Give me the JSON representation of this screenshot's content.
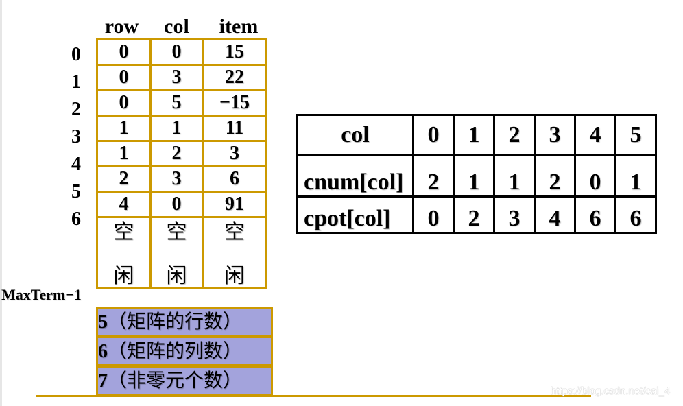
{
  "triple_table": {
    "headers": [
      "row",
      "col",
      "item"
    ],
    "index_labels": [
      "0",
      "1",
      "2",
      "3",
      "4",
      "5",
      "6"
    ],
    "rows": [
      {
        "row": "0",
        "col": "0",
        "item": "15"
      },
      {
        "row": "0",
        "col": "3",
        "item": "22"
      },
      {
        "row": "0",
        "col": "5",
        "item": "−15"
      },
      {
        "row": "1",
        "col": "1",
        "item": "11"
      },
      {
        "row": "1",
        "col": "2",
        "item": "3"
      },
      {
        "row": "2",
        "col": "3",
        "item": "6"
      },
      {
        "row": "4",
        "col": "0",
        "item": "91"
      }
    ],
    "free_cells": {
      "top": "空",
      "bottom": "闲"
    },
    "maxterm_label": "MaxTerm−1",
    "meta_rows": [
      {
        "num": "5",
        "text": "（矩阵的行数）"
      },
      {
        "num": "6",
        "text": "（矩阵的列数）"
      },
      {
        "num": "7",
        "text": "（非零元个数）"
      }
    ]
  },
  "count_table": {
    "rows": [
      {
        "label": "col",
        "values": [
          "0",
          "1",
          "2",
          "3",
          "4",
          "5"
        ]
      },
      {
        "label": "cnum[col]",
        "values": [
          "2",
          "1",
          "1",
          "2",
          "0",
          "1"
        ]
      },
      {
        "label": "cpot[col]",
        "values": [
          "0",
          "2",
          "3",
          "4",
          "6",
          "6"
        ]
      }
    ]
  },
  "colors": {
    "grid_border": "#cc9900",
    "meta_fill": "#a3a3dc",
    "count_border": "#000000"
  },
  "watermark": "https://blog.csdn.net/cai_4"
}
